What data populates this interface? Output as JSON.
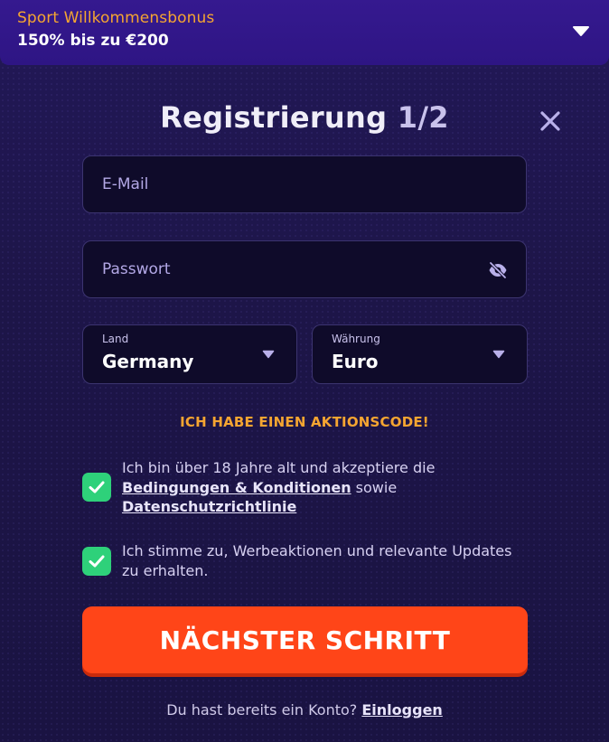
{
  "bonus": {
    "title": "Sport Willkommensbonus",
    "amount": "150% bis zu €200",
    "toggle_icon": "chevron-down-icon"
  },
  "modal": {
    "title": "Registrierung",
    "step": "1/2",
    "close_icon": "close-icon"
  },
  "form": {
    "email_placeholder": "E-Mail",
    "password_placeholder": "Passwort",
    "password_toggle_icon": "eye-slash-icon",
    "country": {
      "label": "Land",
      "value": "Germany"
    },
    "currency": {
      "label": "Währung",
      "value": "Euro"
    }
  },
  "promo_link": "ICH HABE EINEN AKTIONSCODE!",
  "consents": [
    {
      "checked": true,
      "text_before": "Ich bin über 18 Jahre alt und akzeptiere die ",
      "link1": "Bedingungen & Konditionen",
      "text_middle": " sowie ",
      "link2": "Datenschutzrichtlinie"
    },
    {
      "checked": true,
      "text": "Ich stimme zu, Werbeaktionen und relevante Updates zu erhalten."
    }
  ],
  "next_button": "NÄCHSTER SCHRITT",
  "login": {
    "prompt": "Du hast bereits ein Konto?",
    "link": "Einloggen"
  },
  "colors": {
    "background": "#1c1546",
    "bonus_bar": "#32198a",
    "accent_orange": "#f5a531",
    "primary_button": "#ff4518",
    "checkbox_green": "#2ed17a",
    "field_bg": "#0f0b2a"
  }
}
